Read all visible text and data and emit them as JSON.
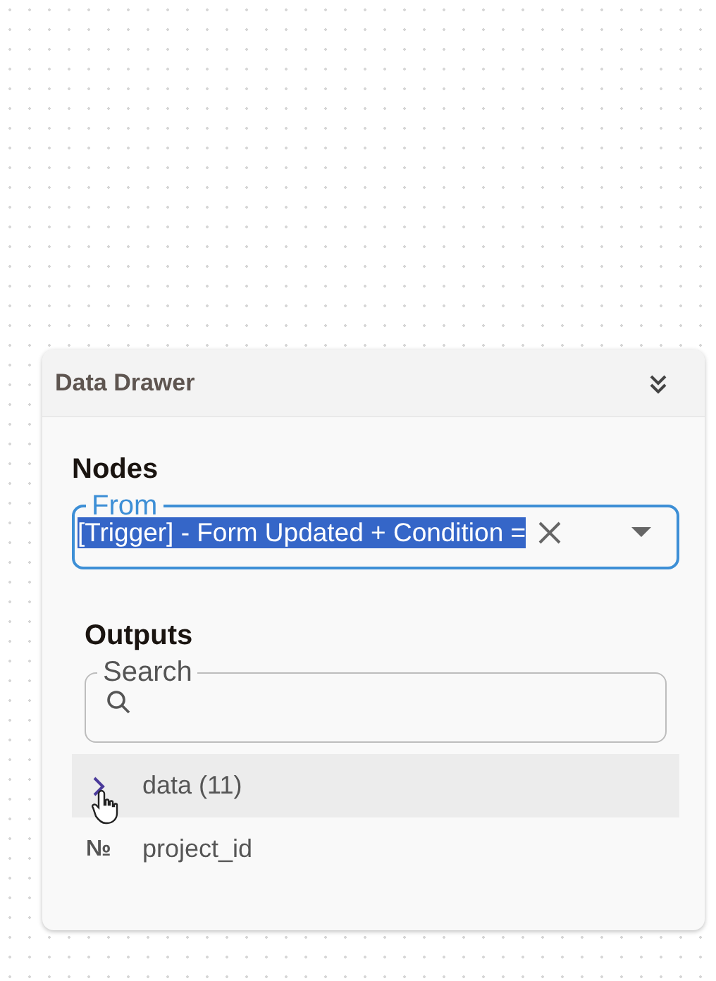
{
  "drawer": {
    "title": "Data Drawer",
    "collapsed": false
  },
  "nodes": {
    "heading": "Nodes",
    "field": {
      "label": "From",
      "value": "[Trigger] - Form Updated + Condition =",
      "focused": true,
      "text_selected": true
    }
  },
  "outputs": {
    "heading": "Outputs",
    "search": {
      "label": "Search"
    },
    "items": [
      {
        "kind": "group",
        "label": "data (11)",
        "highlighted": true
      },
      {
        "kind": "number",
        "type_glyph": "№",
        "label": "project_id",
        "highlighted": false
      }
    ]
  }
}
